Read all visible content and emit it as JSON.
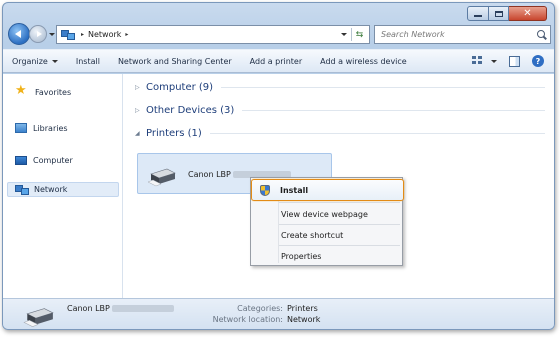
{
  "address": {
    "crumbs": [
      "Network"
    ],
    "separator": "▸"
  },
  "search": {
    "placeholder": "Search Network"
  },
  "toolbar": {
    "organize": "Organize",
    "install": "Install",
    "network_sharing": "Network and Sharing Center",
    "add_printer": "Add a printer",
    "add_wireless": "Add a wireless device",
    "help": "?"
  },
  "nav": {
    "favorites": "Favorites",
    "libraries": "Libraries",
    "computer": "Computer",
    "network": "Network"
  },
  "groups": {
    "computer": "Computer (9)",
    "other": "Other Devices (3)",
    "printers": "Printers (1)"
  },
  "printer": {
    "name": "Canon LBP"
  },
  "context_menu": {
    "install": "Install",
    "view_webpage": "View device webpage",
    "create_shortcut": "Create shortcut",
    "properties": "Properties"
  },
  "details": {
    "name": "Canon LBP",
    "categories_label": "Categories:",
    "categories_value": "Printers",
    "location_label": "Network location:",
    "location_value": "Network"
  },
  "colors": {
    "accent": "#e38b16",
    "selection": "#dde9f7",
    "title_bar": "#c9daee"
  }
}
